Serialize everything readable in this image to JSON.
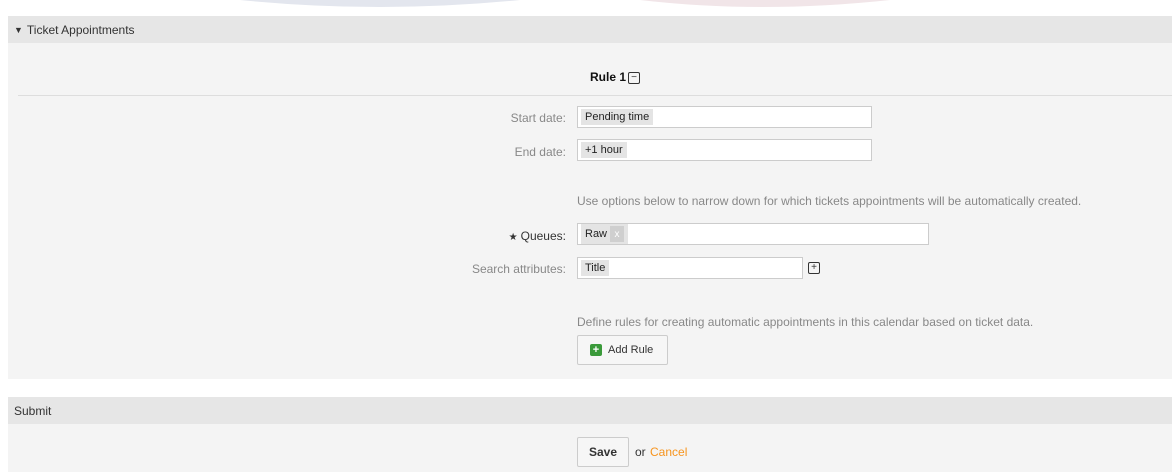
{
  "colors": {
    "header_bg": "#e6e6e6",
    "body_bg": "#f4f4f4",
    "link": "#f7941d",
    "add_icon": "#3a9a3a"
  },
  "ticket_appointments": {
    "header_title": "Ticket Appointments",
    "rule_title": "Rule 1",
    "start_date": {
      "label": "Start date:",
      "value": "Pending time"
    },
    "end_date": {
      "label": "End date:",
      "value": "+1 hour"
    },
    "narrow_help": "Use options below to narrow down for which tickets appointments will be automatically created.",
    "queues": {
      "required_mark": "★",
      "label": "Queues:",
      "value": "Raw",
      "remove": "x"
    },
    "search_attributes": {
      "label": "Search attributes:",
      "value": "Title"
    },
    "define_help": "Define rules for creating automatic appointments in this calendar based on ticket data.",
    "add_rule_label": "Add Rule"
  },
  "submit": {
    "header_title": "Submit",
    "save_label": "Save",
    "or_text": "or",
    "cancel_label": "Cancel"
  }
}
